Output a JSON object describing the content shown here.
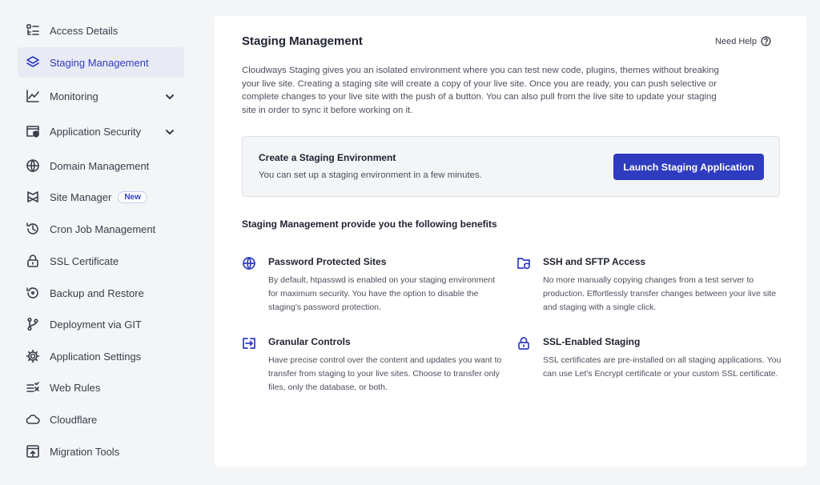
{
  "sidebar": {
    "items": [
      {
        "label": "Access Details",
        "icon": "access-details-icon"
      },
      {
        "label": "Staging Management",
        "icon": "layers-icon",
        "active": true
      },
      {
        "label": "Monitoring",
        "icon": "chart-line-icon",
        "expandable": true
      },
      {
        "label": "Application Security",
        "icon": "app-shield-icon",
        "expandable": true
      },
      {
        "label": "Domain Management",
        "icon": "www-globe-icon"
      },
      {
        "label": "Site Manager",
        "icon": "site-manager-icon",
        "badge": "New"
      },
      {
        "label": "Cron Job Management",
        "icon": "history-clock-icon"
      },
      {
        "label": "SSL Certificate",
        "icon": "lock-icon"
      },
      {
        "label": "Backup and Restore",
        "icon": "backup-icon"
      },
      {
        "label": "Deployment via GIT",
        "icon": "git-branch-icon"
      },
      {
        "label": "Application Settings",
        "icon": "gear-icon"
      },
      {
        "label": "Web Rules",
        "icon": "rules-icon"
      },
      {
        "label": "Cloudflare",
        "icon": "cloud-icon"
      },
      {
        "label": "Migration Tools",
        "icon": "migration-icon"
      }
    ]
  },
  "main": {
    "title": "Staging Management",
    "help_label": "Need Help",
    "intro": "Cloudways Staging gives you an isolated environment where you can test new code, plugins, themes without breaking your live site. Creating a staging site will create a copy of your live site. Once you are ready, you can push selective or complete changes to your live site with the push of a button. You can also pull from the live site to update your staging site in order to sync it before working on it.",
    "create": {
      "title": "Create a Staging Environment",
      "subtitle": "You can set up a staging environment in a few minutes.",
      "button_label": "Launch Staging Application"
    },
    "benefits_title": "Staging Management provide you the following benefits",
    "benefits": [
      {
        "title": "Password Protected Sites",
        "icon": "globe-icon",
        "desc": "By default, htpasswd is enabled on your staging environment for maximum security. You have the option to disable the staging's password protection."
      },
      {
        "title": "SSH and SFTP Access",
        "icon": "folder-shield-icon",
        "desc": "No more manually copying changes from a test server to production. Effortlessly transfer changes between your live site and staging with a single click."
      },
      {
        "title": "Granular Controls",
        "icon": "transfer-icon",
        "desc": "Have precise control over the content and updates you want to transfer from staging to your live sites. Choose to transfer only files, only the database, or both."
      },
      {
        "title": "SSL-Enabled Staging",
        "icon": "lock-icon",
        "desc": "SSL certificates are pre-installed on all staging applications. You can use Let's Encrypt certificate or your custom SSL certificate."
      }
    ]
  },
  "colors": {
    "accent": "#2f3cc0",
    "active_bg": "#e9ebf4",
    "page_bg": "#f4f5f7"
  }
}
